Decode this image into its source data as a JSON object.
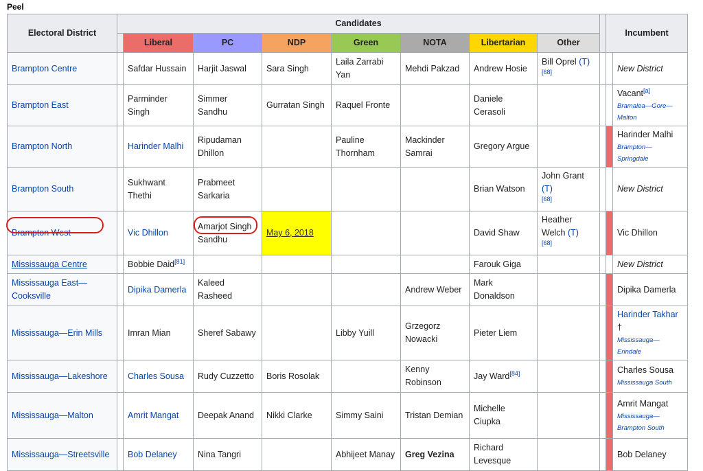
{
  "caption": "Peel",
  "header": {
    "electoral_district": "Electoral District",
    "candidates": "Candidates",
    "incumbent": "Incumbent",
    "parties": [
      {
        "name": "Liberal",
        "color": "#ea6d6a"
      },
      {
        "name": "PC",
        "color": "#9999ff"
      },
      {
        "name": "NDP",
        "color": "#f4a460"
      },
      {
        "name": "Green",
        "color": "#99c955"
      },
      {
        "name": "NOTA",
        "color": "#aaaaaa"
      },
      {
        "name": "Libertarian",
        "color": "#fed700"
      },
      {
        "name": "Other",
        "color": "#dddddd"
      }
    ]
  },
  "incumbent_color": "#ea6d6a",
  "rows": [
    {
      "district": "Brampton Centre",
      "liberal": "Safdar Hussain",
      "pc": "Harjit Jaswal",
      "ndp": "Sara Singh",
      "green": "Laila Zarrabi Yan",
      "nota": "Mehdi Pakzad",
      "libertarian": "Andrew Hosie",
      "other": "Bill Oprel",
      "other_mark": "(T)",
      "other_note": "[68]",
      "incumbent": "New District"
    },
    {
      "district": "Brampton East",
      "liberal": "Parminder Singh",
      "pc": "Simmer Sandhu",
      "ndp": "Gurratan Singh",
      "green": "Raquel Fronte",
      "nota": "",
      "libertarian": "Daniele Cerasoli",
      "other": "",
      "incumbent": "Vacant",
      "incumbent_note": "[a]",
      "incumbent_sub": "Bramalea—Gore—Malton"
    },
    {
      "district": "Brampton North",
      "liberal": "Harinder Malhi",
      "pc": "Ripudaman Dhillon",
      "ndp": "",
      "green": "Pauline Thornham",
      "nota": "Mackinder Samrai",
      "libertarian": "Gregory Argue",
      "other": "",
      "incumbent": "Harinder Malhi",
      "incumbent_sub": "Brampton—Springdale"
    },
    {
      "district": "Brampton South",
      "liberal": "Sukhwant Thethi",
      "pc": "Prabmeet Sarkaria",
      "ndp": "",
      "green": "",
      "nota": "",
      "libertarian": "Brian Watson",
      "other": "John Grant",
      "other_mark": "(T)",
      "other_note": "[68]",
      "incumbent": "New District"
    },
    {
      "district": "Brampton West",
      "liberal": "Vic Dhillon",
      "pc": "Amarjot Singh Sandhu",
      "ndp": "May 6, 2018",
      "green": "",
      "nota": "",
      "libertarian": "David Shaw",
      "other": "Heather Welch",
      "other_mark": "(T)",
      "other_note": "[68]",
      "incumbent": "Vic Dhillon"
    },
    {
      "district": "Mississauga Centre",
      "liberal": "Bobbie Daid",
      "liberal_note": "[81]",
      "pc": "",
      "ndp": "",
      "green": "",
      "nota": "",
      "libertarian": "Farouk Giga",
      "other": "",
      "incumbent": "New District"
    },
    {
      "district": "Mississauga East—Cooksville",
      "liberal": "Dipika Damerla",
      "pc": "Kaleed Rasheed",
      "ndp": "",
      "green": "",
      "nota": "Andrew Weber",
      "libertarian": "Mark Donaldson",
      "other": "",
      "incumbent": "Dipika Damerla"
    },
    {
      "district": "Mississauga—Erin Mills",
      "liberal": "Imran Mian",
      "pc": "Sheref Sabawy",
      "ndp": "",
      "green": "Libby Yuill",
      "nota": "Grzegorz Nowacki",
      "libertarian": "Pieter Liem",
      "other": "",
      "incumbent": "Harinder Takhar",
      "incumbent_mark": "†",
      "incumbent_sub": "Mississauga—Erindale"
    },
    {
      "district": "Mississauga—Lakeshore",
      "liberal": "Charles Sousa",
      "pc": "Rudy Cuzzetto",
      "ndp": "Boris Rosolak",
      "green": "",
      "nota": "Kenny Robinson",
      "libertarian": "Jay Ward",
      "libertarian_note": "[84]",
      "other": "",
      "incumbent": "Charles Sousa",
      "incumbent_sub": "Mississauga South"
    },
    {
      "district": "Mississauga—Malton",
      "liberal": "Amrit Mangat",
      "pc": "Deepak Anand",
      "ndp": "Nikki Clarke",
      "green": "Simmy Saini",
      "nota": "Tristan Demian",
      "libertarian": "Michelle Ciupka",
      "other": "",
      "incumbent": "Amrit Mangat",
      "incumbent_sub": "Mississauga—Brampton South"
    },
    {
      "district": "Mississauga—Streetsville",
      "liberal": "Bob Delaney",
      "pc": "Nina Tangri",
      "ndp": "",
      "green": "Abhijeet Manay",
      "nota": "Greg Vezina",
      "libertarian": "Richard Levesque",
      "other": "",
      "incumbent": "Bob Delaney"
    }
  ]
}
